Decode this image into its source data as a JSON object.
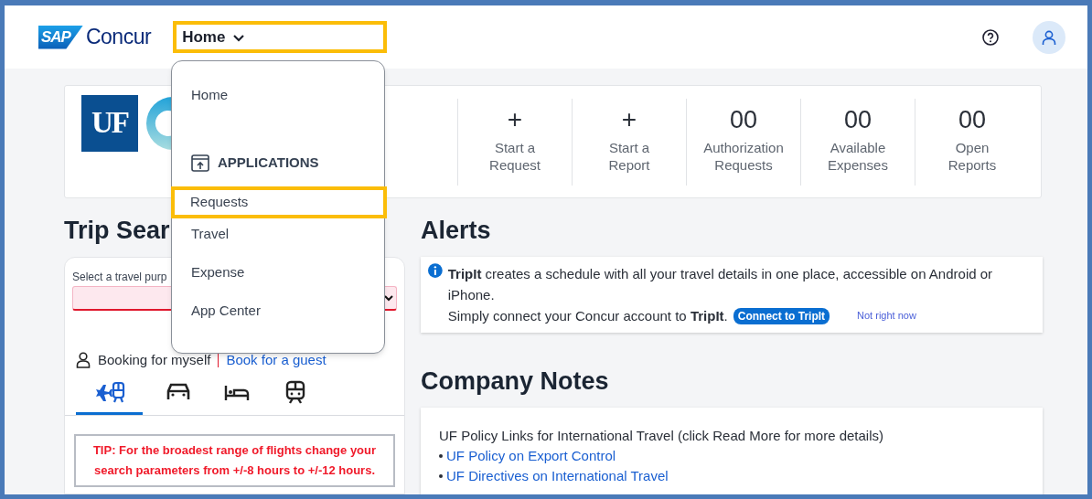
{
  "header": {
    "logo": {
      "mark": "SAP",
      "name": "Concur"
    },
    "nav": {
      "label": "Home",
      "highlighted": true
    }
  },
  "menu": {
    "items": [
      {
        "kind": "link",
        "label": "Home",
        "highlighted": false
      },
      {
        "kind": "section",
        "label": "APPLICATIONS"
      },
      {
        "kind": "link",
        "label": "Requests",
        "highlighted": true
      },
      {
        "kind": "link",
        "label": "Travel",
        "highlighted": false
      },
      {
        "kind": "link",
        "label": "Expense",
        "highlighted": false
      },
      {
        "kind": "link",
        "label": "App Center",
        "highlighted": false
      }
    ]
  },
  "banner": {
    "logo": "UF"
  },
  "quick_actions": [
    {
      "kind": "action",
      "figure": "+",
      "label_lines": [
        "Start a",
        "Request"
      ]
    },
    {
      "kind": "action",
      "figure": "+",
      "label_lines": [
        "Start a",
        "Report"
      ]
    },
    {
      "kind": "count",
      "figure": "00",
      "label_lines": [
        "Authorization",
        "Requests"
      ]
    },
    {
      "kind": "count",
      "figure": "00",
      "label_lines": [
        "Available",
        "Expenses"
      ]
    },
    {
      "kind": "count",
      "figure": "00",
      "label_lines": [
        "Open",
        "Reports"
      ]
    }
  ],
  "trip_search": {
    "title": "Trip Sear",
    "purpose_label": "Select a travel purp",
    "booking_self": "Booking for myself",
    "booking_guest": "Book for a guest",
    "modes": [
      {
        "kind": "air_rail",
        "selected": true
      },
      {
        "kind": "car",
        "selected": false
      },
      {
        "kind": "hotel",
        "selected": false
      },
      {
        "kind": "rail",
        "selected": false
      }
    ],
    "tip": "TIP: For the broadest range of flights change your search parameters from +/-8 hours to +/-12 hours."
  },
  "alerts": {
    "title": "Alerts",
    "message": "**TripIt** creates a schedule with all your travel details in one place, accessible on Android or iPhone.",
    "prompt": "Simply connect your Concur account to **TripIt**.",
    "connect_button": "Connect to TripIt",
    "dismiss_link": "Not right now"
  },
  "company_notes": {
    "title": "Company Notes",
    "intro": "UF Policy Links for International Travel (click Read More for more details)",
    "links": [
      "UF Policy on Export Control",
      "UF Directives on International Travel"
    ]
  }
}
